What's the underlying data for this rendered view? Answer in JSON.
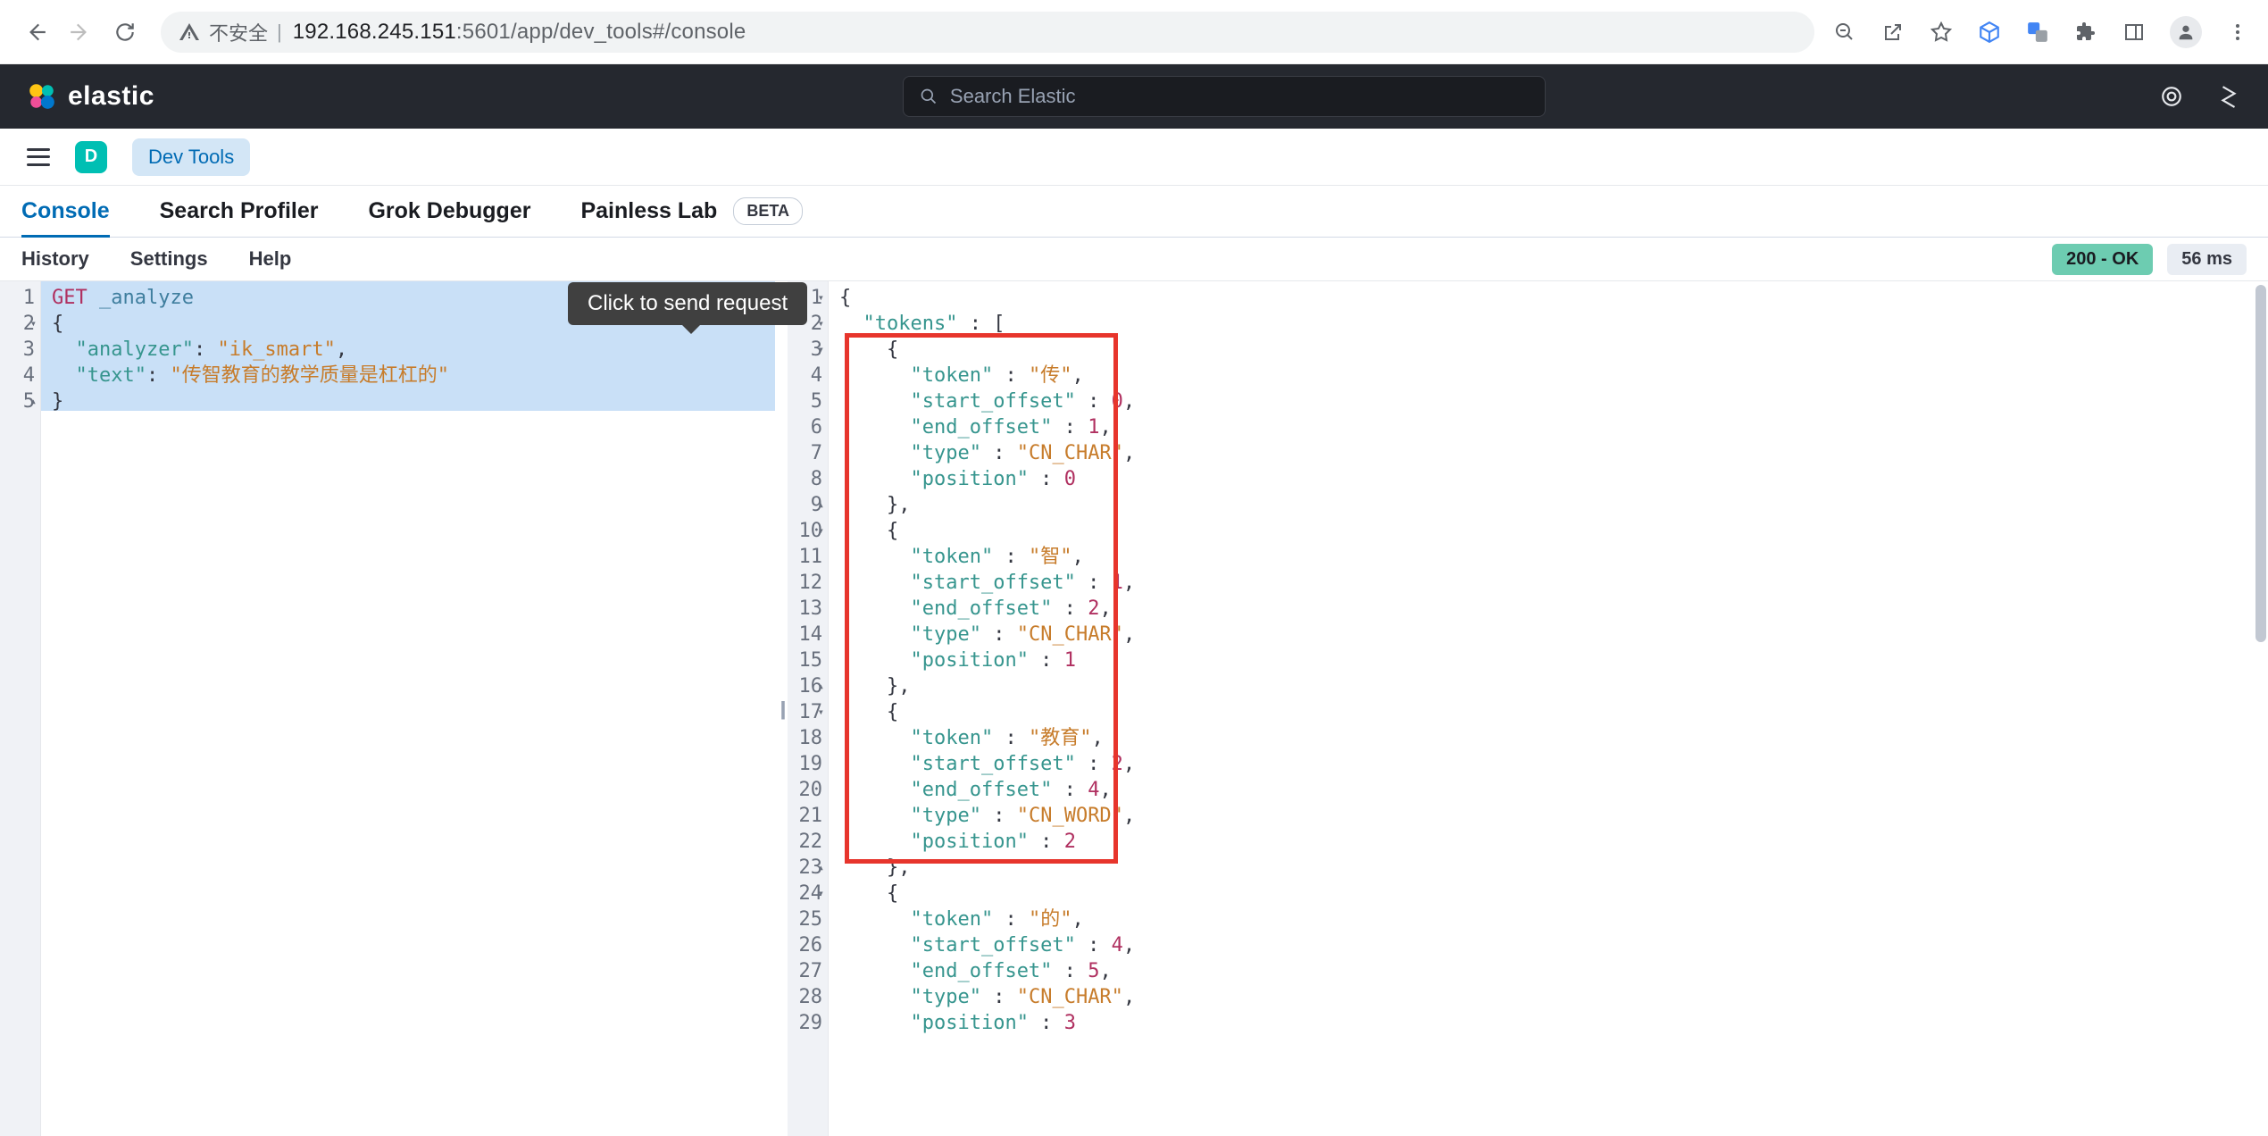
{
  "browser": {
    "security_label": "不安全",
    "url_host": "192.168.245.151",
    "url_port": ":5601",
    "url_path": "/app/dev_tools#/console"
  },
  "elastic": {
    "brand": "elastic",
    "search_placeholder": "Search Elastic"
  },
  "kbn": {
    "badge_letter": "D",
    "app_label": "Dev Tools"
  },
  "tabs": {
    "console": "Console",
    "profiler": "Search Profiler",
    "grok": "Grok Debugger",
    "painless": "Painless Lab",
    "beta": "BETA"
  },
  "subbar": {
    "history": "History",
    "settings": "Settings",
    "help": "Help",
    "status": "200 - OK",
    "time": "56 ms"
  },
  "tooltip": "Click to send request",
  "request": {
    "line1_method": "GET",
    "line1_path": " _analyze",
    "line2": "{",
    "line3_k": "\"analyzer\"",
    "line3_v": "\"ik_smart\"",
    "line4_k": "\"text\"",
    "line4_v": "\"传智教育的教学质量是杠杠的\"",
    "line5": "}"
  },
  "req_gutter": [
    "1",
    "2",
    "3",
    "4",
    "5"
  ],
  "res_gutter": [
    "1",
    "2",
    "3",
    "4",
    "5",
    "6",
    "7",
    "8",
    "9",
    "10",
    "11",
    "12",
    "13",
    "14",
    "15",
    "16",
    "17",
    "18",
    "19",
    "20",
    "21",
    "22",
    "23",
    "24",
    "25",
    "26",
    "27",
    "28",
    "29"
  ],
  "response": {
    "tokens_key": "\"tokens\"",
    "t0": {
      "token": "\"传\"",
      "so": "0",
      "eo": "1",
      "type": "\"CN_CHAR\"",
      "pos": "0"
    },
    "t1": {
      "token": "\"智\"",
      "so": "1",
      "eo": "2",
      "type": "\"CN_CHAR\"",
      "pos": "1"
    },
    "t2": {
      "token": "\"教育\"",
      "so": "2",
      "eo": "4",
      "type": "\"CN_WORD\"",
      "pos": "2"
    },
    "t3": {
      "token": "\"的\"",
      "so": "4",
      "eo": "5",
      "type": "\"CN_CHAR\"",
      "pos": "3"
    },
    "keys": {
      "token": "\"token\"",
      "so": "\"start_offset\"",
      "eo": "\"end_offset\"",
      "type": "\"type\"",
      "pos": "\"position\""
    }
  }
}
